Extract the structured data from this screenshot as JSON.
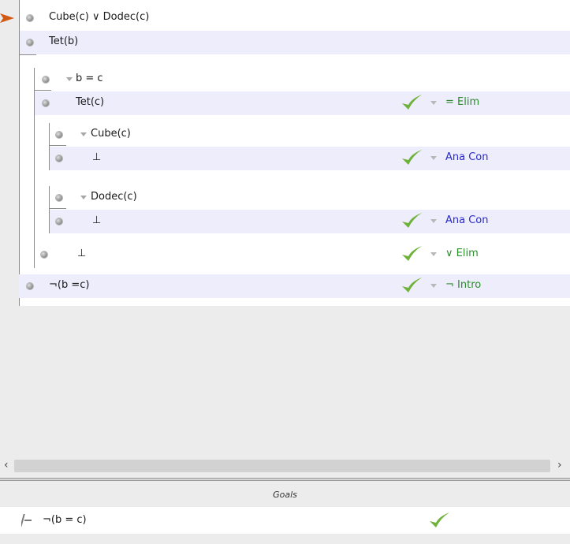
{
  "proof": {
    "premise1": "Cube(c) ∨ Dodec(c)",
    "premise2": "Tet(b)",
    "sub1_assumption": "b = c",
    "sub1_step": "Tet(c)",
    "sub1_step_rule": "= Elim",
    "case1_assumption": "Cube(c)",
    "case1_step": "⊥",
    "case1_rule": "Ana Con",
    "case2_assumption": "Dodec(c)",
    "case2_step": "⊥",
    "case2_rule": "Ana Con",
    "sub1_conclusion": "⊥",
    "sub1_conclusion_rule": "∨ Elim",
    "conclusion": "¬(b =c)",
    "conclusion_rule": "¬ Intro"
  },
  "colors": {
    "rule_green": "#2e8b2e",
    "rule_blue": "#2a2acc",
    "check_green": "#6fb23a",
    "pointer": "#d05a14",
    "shaded_row": "#ededfc"
  },
  "goals": {
    "header": "Goals",
    "items": [
      {
        "formula": "¬(b = c)",
        "icon": "turnstile-icon",
        "status": "check-icon"
      }
    ]
  },
  "scroll": {
    "left_arrow": "‹",
    "right_arrow": "›"
  }
}
